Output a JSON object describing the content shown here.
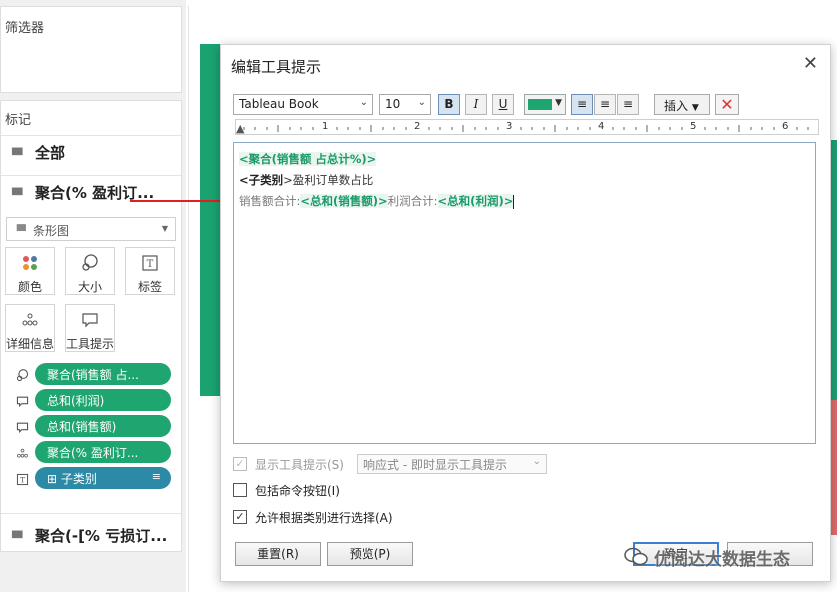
{
  "left_panel": {
    "filters_title": "筛选器",
    "marks_title": "标记",
    "mark_rows": [
      {
        "label": "全部"
      },
      {
        "label": "聚合(% 盈利订..."
      }
    ],
    "mark_type": "条形图",
    "buttons": [
      {
        "label": "颜色",
        "icon": "color-dots-icon"
      },
      {
        "label": "大小",
        "icon": "size-icon"
      },
      {
        "label": "标签",
        "icon": "label-t-icon"
      },
      {
        "label": "详细信息",
        "icon": "detail-dots-icon"
      },
      {
        "label": "工具提示",
        "icon": "tooltip-bubble-icon"
      }
    ],
    "pills": [
      {
        "label": "聚合(销售额 占...",
        "icon": "size-icon",
        "color": "#1fa56f"
      },
      {
        "label": "总和(利润)",
        "icon": "tooltip-bubble-icon",
        "color": "#1fa56f"
      },
      {
        "label": "总和(销售额)",
        "icon": "tooltip-bubble-icon",
        "color": "#1fa56f"
      },
      {
        "label": "聚合(% 盈利订...",
        "icon": "detail-dots-icon",
        "color": "#1fa56f"
      },
      {
        "label": "⊞ 子类别",
        "icon": "label-t-icon",
        "color": "#2c8aa6"
      }
    ],
    "bottom_mark": "聚合(-[% 亏损订..."
  },
  "dialog": {
    "title": "编辑工具提示",
    "font_name": "Tableau Book",
    "font_size": "10",
    "bold_label": "B",
    "italic_label": "I",
    "underline_label": "U",
    "insert_label": "插入",
    "ruler_numbers": [
      "1",
      "2",
      "3",
      "4",
      "5",
      "6"
    ],
    "editor": {
      "line1_token": "<聚合(销售额 占总计%)>",
      "line2_lt": "<",
      "line2_bold": "子类别",
      "line2_rest": ">盈利订单数占比",
      "line3_label1": "销售额合计:",
      "line3_token1": "<总和(销售额)>",
      "line3_label2": "利润合计:",
      "line3_token2": "<总和(利润)>"
    },
    "show_tooltip_label": "显示工具提示(S)",
    "response_option": "响应式 - 即时显示工具提示",
    "include_buttons_label": "包括命令按钮(I)",
    "allow_select_label": "允许根据类别进行选择(A)",
    "reset_label": "重置(R)",
    "preview_label": "预览(P)",
    "ok_label": "确定",
    "watermark_text": "优阅达大数据生态"
  },
  "colors": {
    "pill_green": "#1fa56f",
    "pill_blue": "#2c8aa6",
    "token_green": "#1a9a68",
    "arrow_red": "#e02020"
  }
}
